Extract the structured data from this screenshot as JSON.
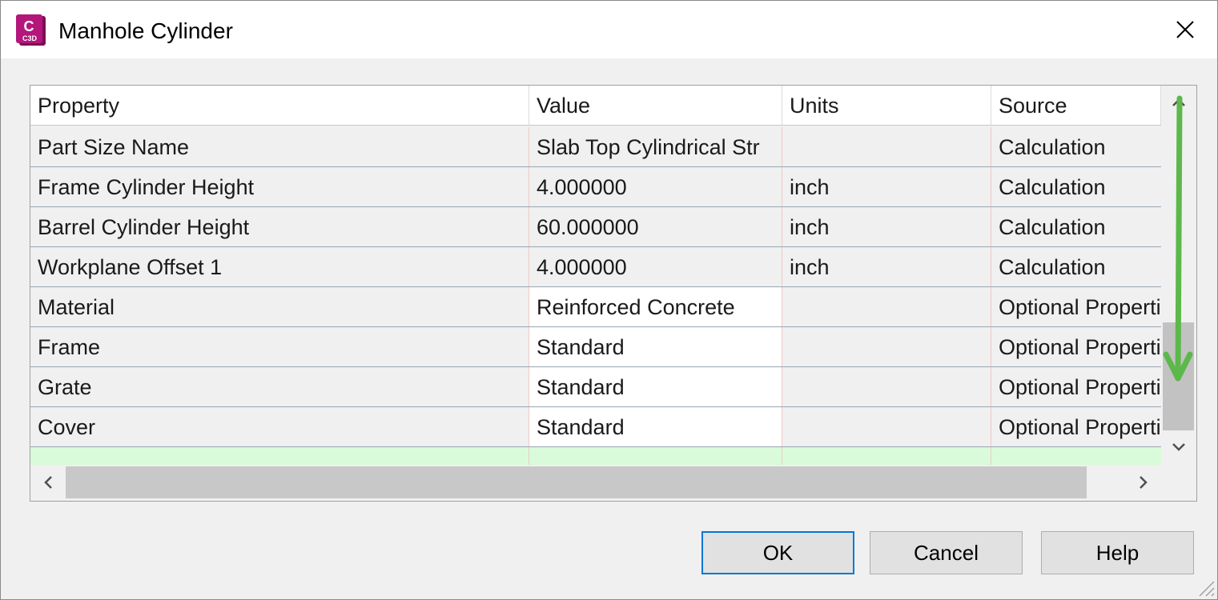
{
  "window": {
    "title": "Manhole Cylinder",
    "app_icon_letter": "C",
    "app_icon_sub": "C3D",
    "accent": "#a0146e"
  },
  "grid": {
    "columns": [
      "Property",
      "Value",
      "Units",
      "Source"
    ],
    "rows": [
      [
        "Part Size Name",
        "Slab Top Cylindrical Str",
        "",
        "Calculation"
      ],
      [
        "Frame Cylinder Height",
        "4.000000",
        "inch",
        "Calculation"
      ],
      [
        "Barrel Cylinder Height",
        "60.000000",
        "inch",
        "Calculation"
      ],
      [
        "Workplane Offset  1",
        "4.000000",
        "inch",
        "Calculation"
      ],
      [
        "Material",
        "Reinforced Concrete",
        "",
        "Optional Properties"
      ],
      [
        "Frame",
        "Standard",
        "",
        "Optional Properties"
      ],
      [
        "Grate",
        "Standard",
        "",
        "Optional Properties"
      ],
      [
        "Cover",
        "Standard",
        "",
        "Optional Properties"
      ]
    ],
    "annotation_color": "#5cb84a"
  },
  "buttons": {
    "ok": "OK",
    "cancel": "Cancel",
    "help": "Help"
  }
}
